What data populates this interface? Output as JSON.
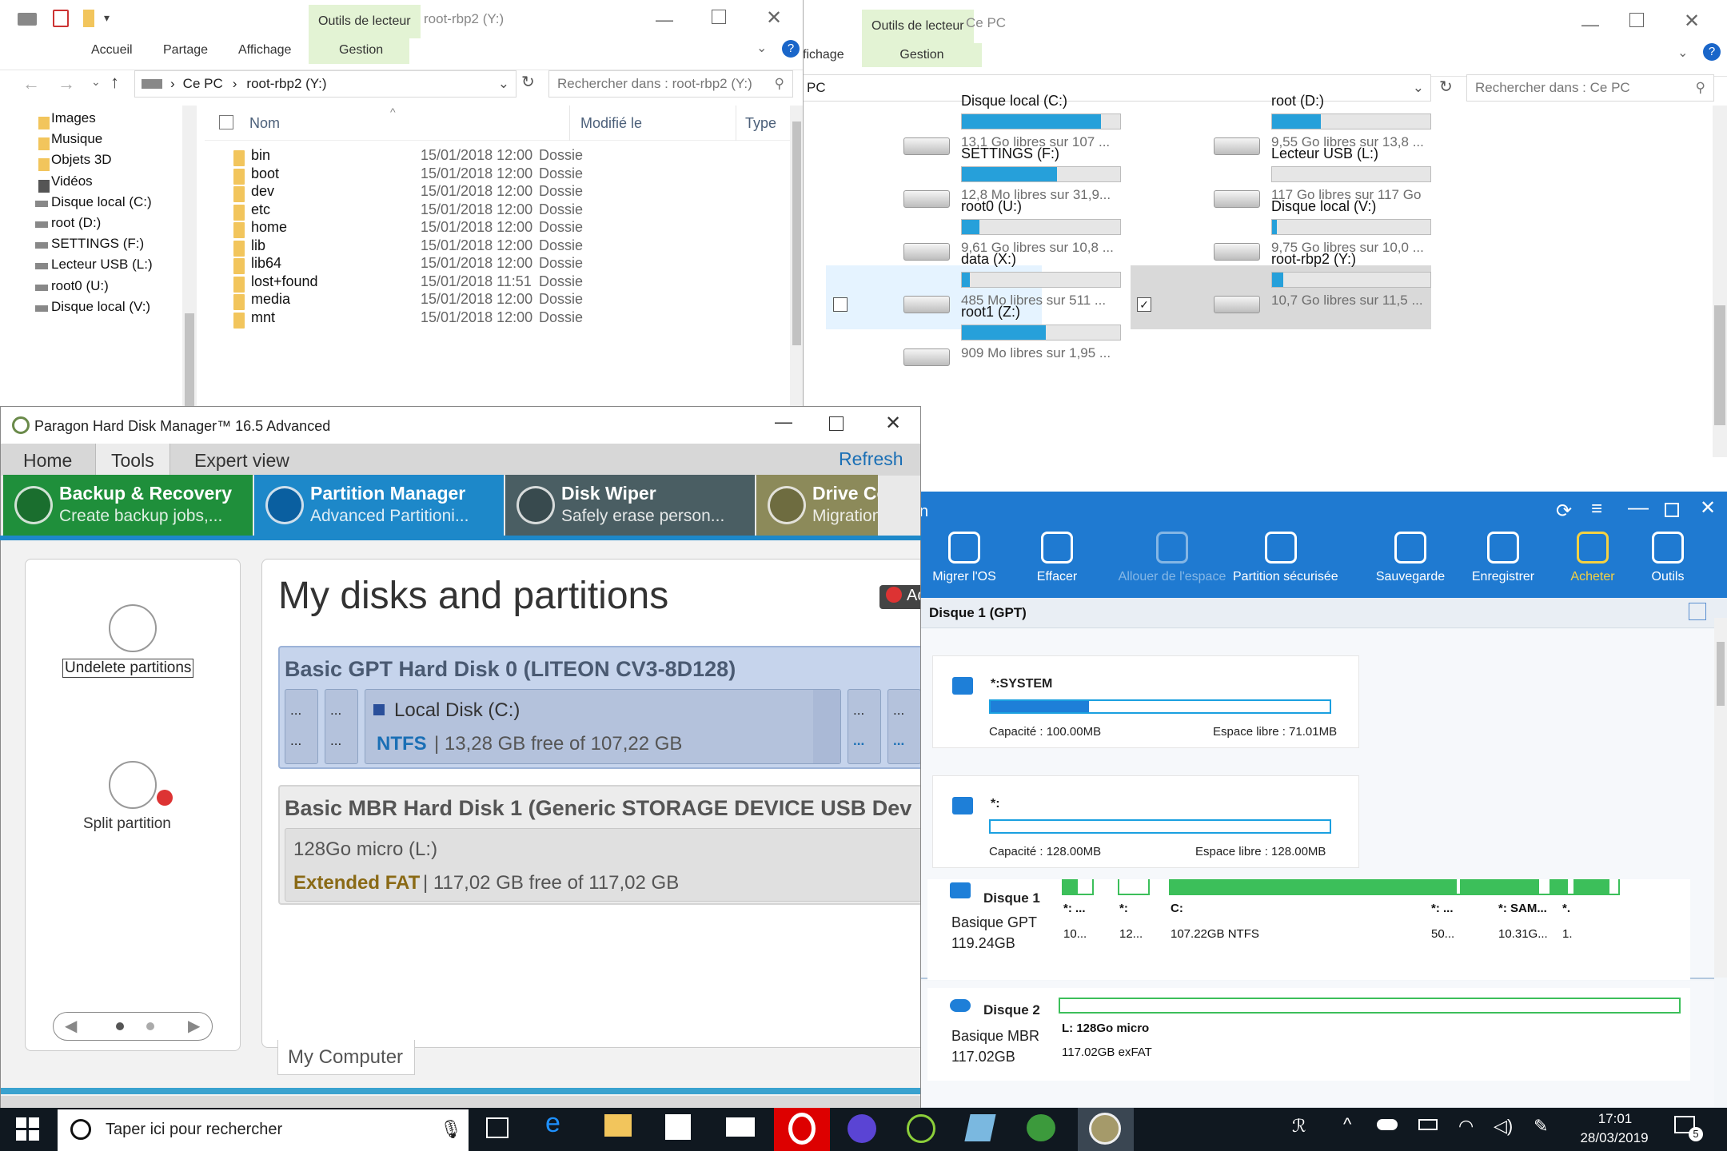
{
  "explorer1": {
    "tab_tool": "Outils de lecteur",
    "title": "root-rbp2 (Y:)",
    "ribbon": [
      "Accueil",
      "Partage",
      "Affichage",
      "Gestion"
    ],
    "path_root": "Ce PC",
    "path_item": "root-rbp2 (Y:)",
    "search_placeholder": "Rechercher dans : root-rbp2 (Y:)",
    "nav": [
      "Images",
      "Musique",
      "Objets 3D",
      "Vidéos",
      "Disque local (C:)",
      "root (D:)",
      "SETTINGS (F:)",
      "Lecteur USB (L:)",
      "root0 (U:)",
      "Disque local (V:)"
    ],
    "col_name": "Nom",
    "col_date": "Modifié le",
    "col_type": "Type",
    "files": [
      {
        "name": "bin",
        "date": "15/01/2018 12:00",
        "type": "Dossie"
      },
      {
        "name": "boot",
        "date": "15/01/2018 12:00",
        "type": "Dossie"
      },
      {
        "name": "dev",
        "date": "15/01/2018 12:00",
        "type": "Dossie"
      },
      {
        "name": "etc",
        "date": "15/01/2018 12:00",
        "type": "Dossie"
      },
      {
        "name": "home",
        "date": "15/01/2018 12:00",
        "type": "Dossie"
      },
      {
        "name": "lib",
        "date": "15/01/2018 12:00",
        "type": "Dossie"
      },
      {
        "name": "lib64",
        "date": "15/01/2018 12:00",
        "type": "Dossie"
      },
      {
        "name": "lost+found",
        "date": "15/01/2018 11:51",
        "type": "Dossie"
      },
      {
        "name": "media",
        "date": "15/01/2018 12:00",
        "type": "Dossie"
      },
      {
        "name": "mnt",
        "date": "15/01/2018 12:00",
        "type": "Dossie"
      }
    ]
  },
  "explorer2": {
    "tab_tool": "Outils de lecteur",
    "title": "Ce PC",
    "ribbon_partial": "fichage",
    "ribbon_manage": "Gestion",
    "path": "PC",
    "search_placeholder": "Rechercher dans : Ce PC",
    "drives": [
      {
        "label": "Disque local (C:)",
        "free": "13,1 Go libres sur 107 ...",
        "fill": 0.88
      },
      {
        "label": "root (D:)",
        "free": "9,55 Go libres sur 13,8 ...",
        "fill": 0.31
      },
      {
        "label": "SETTINGS (F:)",
        "free": "12,8 Mo libres sur 31,9...",
        "fill": 0.6
      },
      {
        "label": "Lecteur USB (L:)",
        "free": "117 Go libres sur 117 Go",
        "fill": 0.0
      },
      {
        "label": "root0 (U:)",
        "free": "9,61 Go libres sur 10,8 ...",
        "fill": 0.11
      },
      {
        "label": "Disque local (V:)",
        "free": "9,75 Go libres sur 10,0 ...",
        "fill": 0.03
      },
      {
        "label": "data (X:)",
        "free": "485 Mo libres sur 511 ...",
        "fill": 0.05
      },
      {
        "label": "root-rbp2 (Y:)",
        "free": "10,7 Go libres sur 11,5 ...",
        "fill": 0.07
      },
      {
        "label": "root1 (Z:)",
        "free": "909 Mo libres sur 1,95 ...",
        "fill": 0.53
      }
    ]
  },
  "paragon": {
    "title": "Paragon Hard Disk Manager™ 16.5 Advanced",
    "menu": [
      "Home",
      "Tools",
      "Expert view"
    ],
    "refresh": "Refresh",
    "tabs": [
      {
        "title": "Backup & Recovery",
        "sub": "Create backup jobs,..."
      },
      {
        "title": "Partition Manager",
        "sub": "Advanced Partitioni..."
      },
      {
        "title": "Disk Wiper",
        "sub": "Safely erase person..."
      },
      {
        "title": "Drive Copy",
        "sub": "Migration an"
      }
    ],
    "undelete": "Undelete partitions",
    "split": "Split partition",
    "heading": "My disks and partitions",
    "badge": "Ac",
    "disk0": "Basic GPT Hard Disk 0 (LITEON CV3-8D128)",
    "disk0_part": "Local Disk (C:)",
    "disk0_fs": "NTFS",
    "disk0_free": "13,28 GB free of 107,22 GB",
    "dots": "...",
    "disk1": "Basic MBR Hard Disk 1 (Generic STORAGE DEVICE USB Dev",
    "disk1_part": "128Go micro (L:)",
    "disk1_fs": "Extended FAT",
    "disk1_free": "117,02 GB free of 117,02 GB",
    "bottom_tab": "My Computer"
  },
  "easeus": {
    "tools": [
      "Migrer l'OS",
      "Effacer",
      "Allouer de l'espace",
      "Partition sécurisée",
      "Sauvegarde",
      "Enregistrer",
      "Acheter",
      "Outils"
    ],
    "disk_header": "Disque 1 (GPT)",
    "card1": {
      "name": "*:SYSTEM",
      "cap": "Capacité : 100.00MB",
      "free": "Espace libre : 71.01MB",
      "fill": 0.29
    },
    "card2": {
      "name": "*:",
      "cap": "Capacité : 128.00MB",
      "free": "Espace libre : 128.00MB",
      "fill": 0.0
    },
    "d1": {
      "name": "Disque 1",
      "type": "Basique GPT",
      "size": "119.24GB"
    },
    "d1_parts": [
      {
        "l": "*: ...",
        "s": "10..."
      },
      {
        "l": "*:",
        "s": "12..."
      },
      {
        "l": "C:",
        "s": "107.22GB NTFS"
      },
      {
        "l": "*: ...",
        "s": "50..."
      },
      {
        "l": "*: SAM...",
        "s": "10.31G..."
      },
      {
        "l": "*.",
        "s": "1."
      }
    ],
    "d2": {
      "name": "Disque 2",
      "type": "Basique MBR",
      "size": "117.02GB"
    },
    "d2_part": {
      "l": "L: 128Go micro",
      "s": "117.02GB exFAT"
    }
  },
  "taskbar": {
    "search": "Taper ici pour rechercher",
    "time": "17:01",
    "date": "28/03/2019",
    "notif": "5"
  }
}
